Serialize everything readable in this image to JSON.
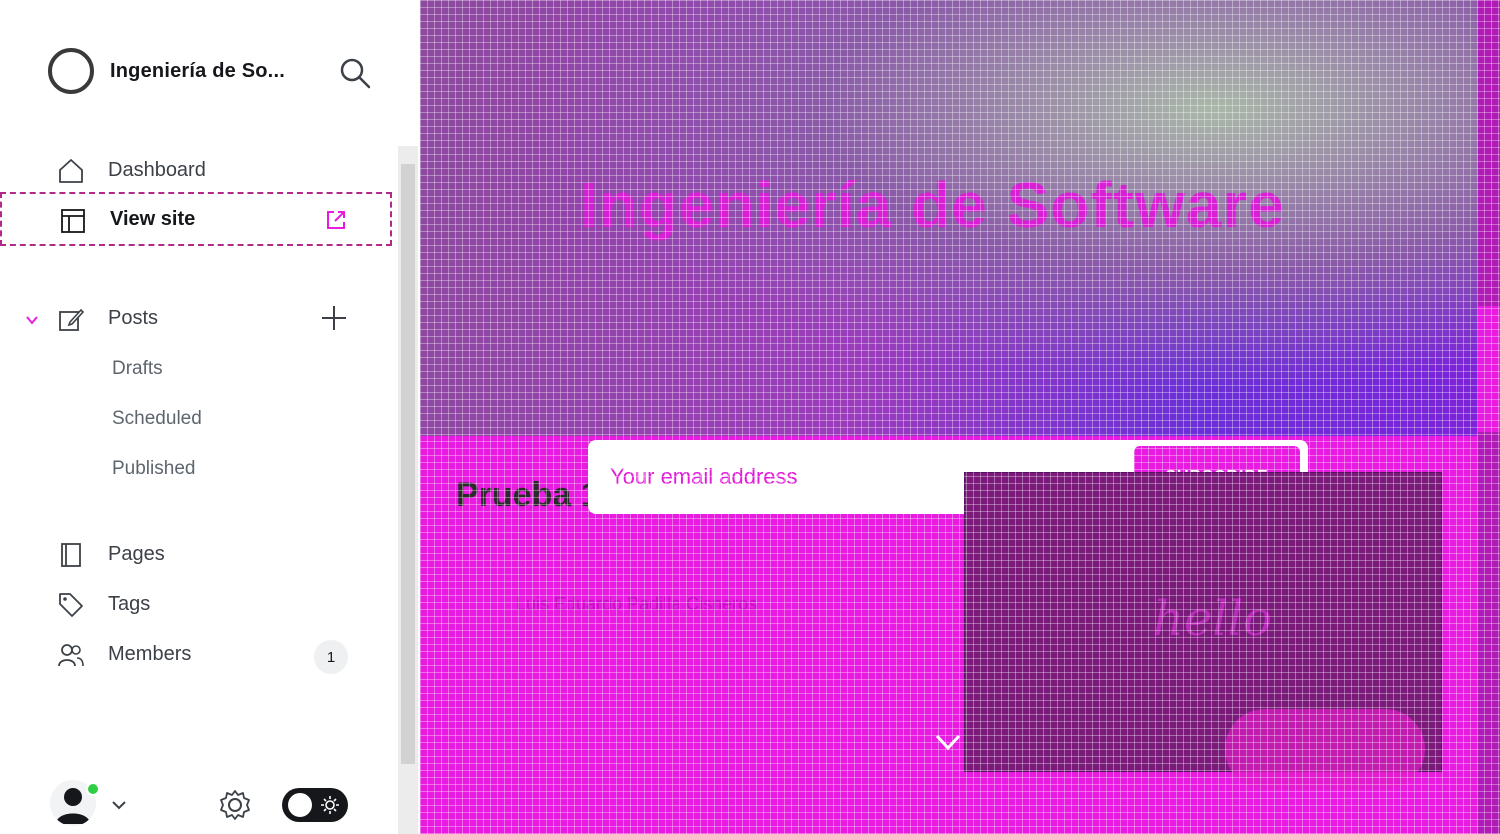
{
  "sidebar": {
    "site_name": "Ingeniería de So...",
    "nav": {
      "dashboard": "Dashboard",
      "view_site": "View site",
      "posts": "Posts",
      "drafts": "Drafts",
      "scheduled": "Scheduled",
      "published": "Published",
      "pages": "Pages",
      "tags": "Tags",
      "members": "Members",
      "members_count": "1"
    }
  },
  "preview": {
    "hero_title": "Ingeniería de Software",
    "subscribe_placeholder": "Your email address",
    "subscribe_button": "SUBSCRIBE",
    "post_title": "Prueba 1",
    "post_author": "Luis Eduardo Padilla Cisneros",
    "card_text": "hello"
  },
  "colors": {
    "accent": "#e81ce0",
    "online": "#30cf43"
  }
}
